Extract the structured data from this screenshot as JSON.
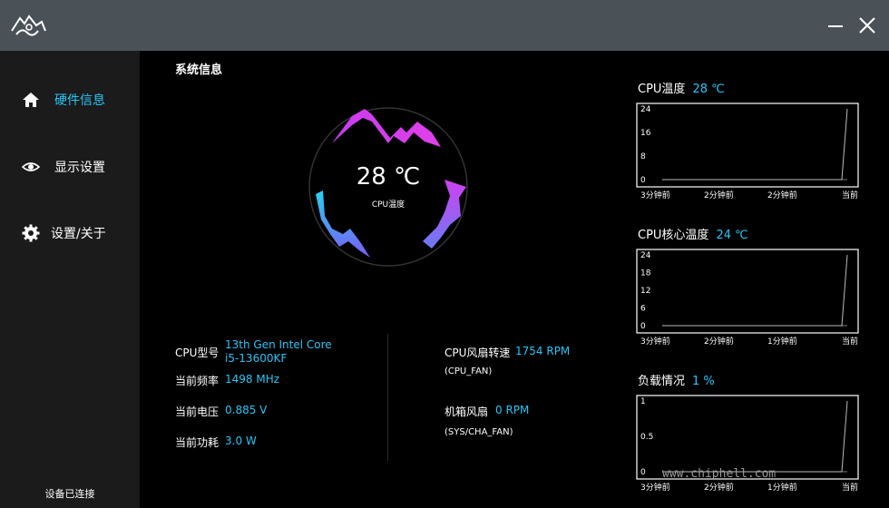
{
  "window": {
    "minimize_label": "minimize",
    "close_label": "close"
  },
  "sidebar": {
    "items": [
      {
        "label": "硬件信息",
        "icon": "home-icon",
        "active": true
      },
      {
        "label": "显示设置",
        "icon": "eye-icon",
        "active": false
      },
      {
        "label": "设置/关于",
        "icon": "gear-icon",
        "active": false
      }
    ],
    "status": "设备已连接"
  },
  "main": {
    "title": "系统信息",
    "gauge": {
      "temp": "28 ℃",
      "label": "CPU温度"
    },
    "info_left": [
      {
        "label": "CPU型号",
        "value": "13th Gen Intel Core",
        "value2": "i5-13600KF"
      },
      {
        "label": "当前频率",
        "value": "1498 MHz"
      },
      {
        "label": "当前电压",
        "value": "0.885 V"
      },
      {
        "label": "当前功耗",
        "value": "3.0 W"
      }
    ],
    "info_right": [
      {
        "label": "CPU风扇转速",
        "value": "1754 RPM",
        "sub": "(CPU_FAN)"
      },
      {
        "label": "机箱风扇",
        "value": "0 RPM",
        "sub": "(SYS/CHA_FAN)"
      }
    ]
  },
  "accent_color": "#29c5f6",
  "watermark": "www.chiphell.com",
  "chart_data": [
    {
      "type": "line",
      "title": "CPU温度",
      "current": "28 ℃",
      "x_ticks": [
        "3分钟前",
        "2分钟前",
        "2分钟前",
        "当前"
      ],
      "y_ticks": [
        "0",
        "8",
        "16",
        "24"
      ],
      "ylim": [
        0,
        28
      ],
      "values": [
        0,
        0,
        0,
        0,
        0,
        0,
        0,
        0,
        28
      ]
    },
    {
      "type": "line",
      "title": "CPU核心温度",
      "current": "24 ℃",
      "x_ticks": [
        "3分钟前",
        "2分钟前",
        "1分钟前",
        "当前"
      ],
      "y_ticks": [
        "0",
        "6",
        "12",
        "18",
        "24"
      ],
      "ylim": [
        0,
        24
      ],
      "values": [
        0,
        0,
        0,
        0,
        0,
        0,
        0,
        0,
        24
      ]
    },
    {
      "type": "line",
      "title": "负载情况",
      "current": "1 %",
      "x_ticks": [
        "3分钟前",
        "2分钟前",
        "1分钟前",
        "当前"
      ],
      "y_ticks": [
        "0",
        "0.5",
        "1"
      ],
      "ylim": [
        0,
        1
      ],
      "values": [
        0,
        0,
        0,
        0,
        0,
        0,
        0,
        0,
        1
      ]
    }
  ]
}
